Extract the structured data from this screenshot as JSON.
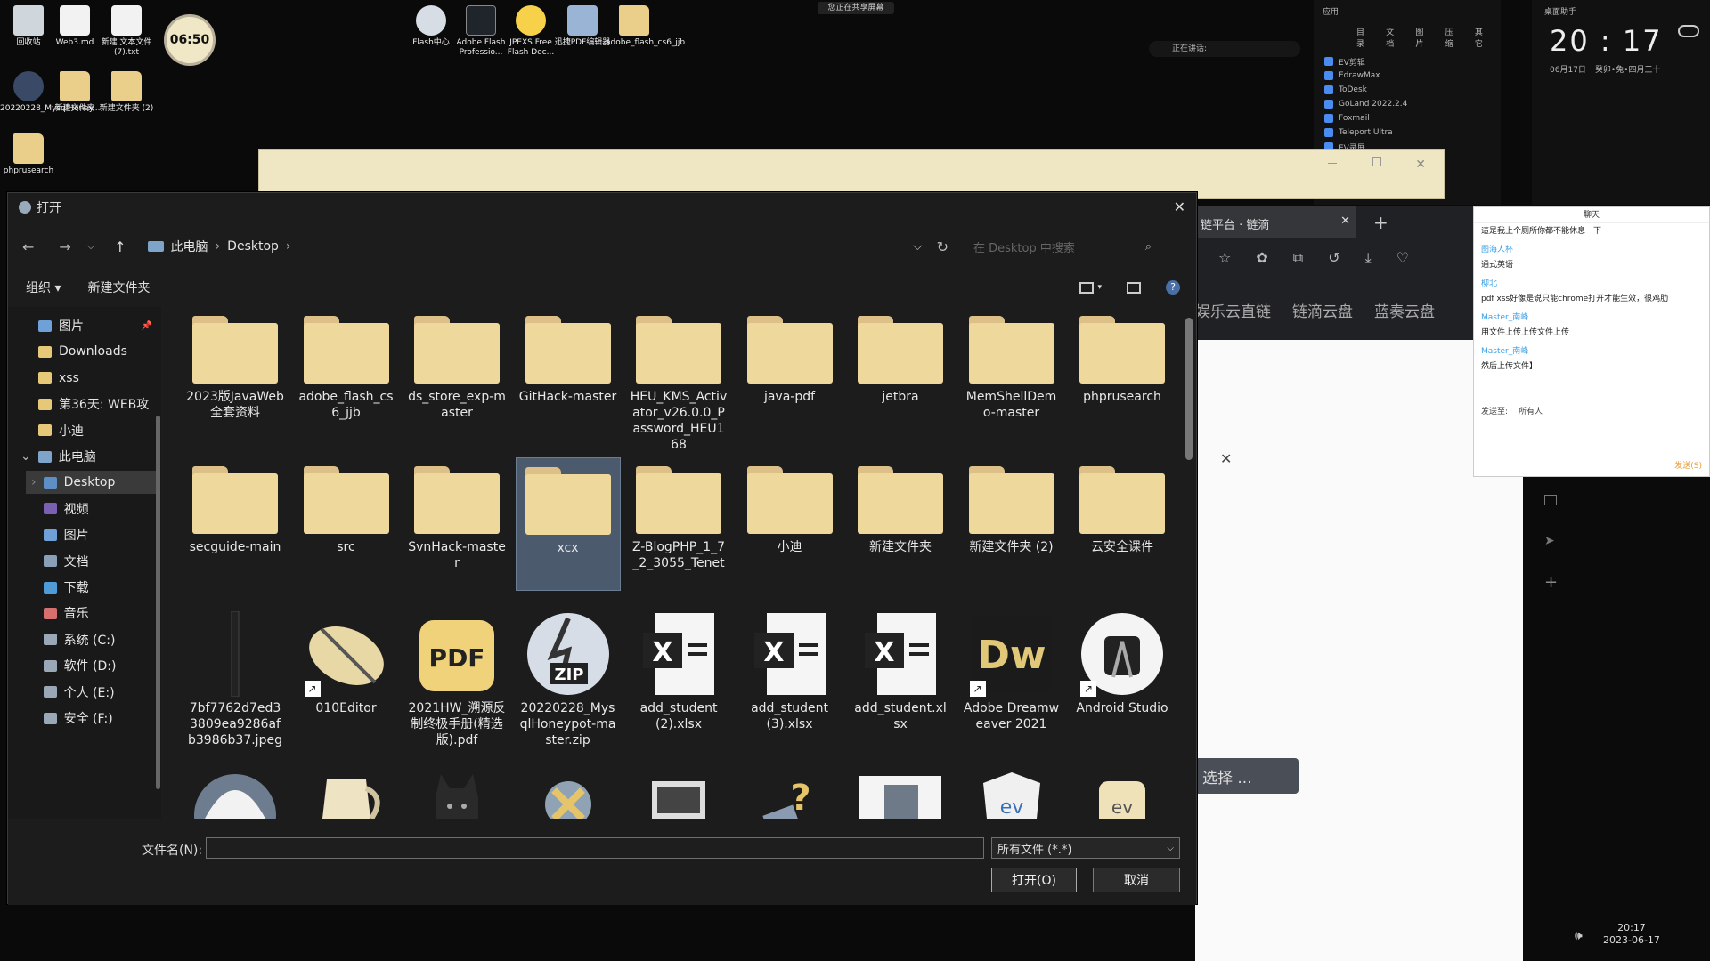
{
  "desktop": {
    "icons_left": [
      {
        "label": "回收站",
        "kind": "bin"
      },
      {
        "label": "Web3.md",
        "kind": "doc"
      },
      {
        "label": "新建 文本文件 (7).txt",
        "kind": "doc"
      },
      {
        "label": "20220228_MysqlHoney...",
        "kind": "zip"
      },
      {
        "label": "新建文件夹",
        "kind": "fold"
      },
      {
        "label": "新建文件夹 (2)",
        "kind": "fold"
      },
      {
        "label": "phprusearch",
        "kind": "fold"
      }
    ],
    "clock_widget": "06:50",
    "icons_top": [
      {
        "label": "Flash中心",
        "kind": "flash"
      },
      {
        "label": "Adobe Flash Professio...",
        "kind": "fl"
      },
      {
        "label": "JPEXS Free Flash Dec...",
        "kind": "ff"
      },
      {
        "label": "迅捷PDF编辑器",
        "kind": "pdf"
      },
      {
        "label": "adobe_flash_cs6_jjb",
        "kind": "fold"
      }
    ],
    "sharing_banner": "您正在共享屏幕",
    "speaking_label": "正在讲话:"
  },
  "app_panel": {
    "header": "应用",
    "tabs": [
      "目录",
      "文档",
      "图片",
      "压缩",
      "其它"
    ],
    "items": [
      "EV剪辑",
      "EdrawMax",
      "ToDesk",
      "GoLand 2022.2.4",
      "Foxmail",
      "Teleport Ultra",
      "EV录屏"
    ]
  },
  "time_panel": {
    "header": "桌面助手",
    "time": "20 : 17",
    "date": "06月17日",
    "lunar": "癸卯•兔•四月三十"
  },
  "browser": {
    "tab_title": "链平台 · 链滴",
    "bookmarks": [
      "娱乐云直链",
      "链滴云盘",
      "蓝奏云盘"
    ],
    "select_button": "选择 ..."
  },
  "chat": {
    "title": "聊天",
    "messages": [
      {
        "type": "msg",
        "text": "這是我上个厕所你都不能休息一下"
      },
      {
        "type": "name",
        "text": "图海人杯"
      },
      {
        "type": "msg",
        "text": "通式英语"
      },
      {
        "type": "name",
        "text": "柳北"
      },
      {
        "type": "msg",
        "text": "pdf xss好像是说只能chrome打开才能生效，很鸡肋"
      },
      {
        "type": "name",
        "text": "Master_南峰"
      },
      {
        "type": "msg",
        "text": "用文件上传上传文件上传"
      },
      {
        "type": "name",
        "text": "Master_南峰"
      },
      {
        "type": "msg",
        "text": "然后上传文件】"
      }
    ],
    "send_to_label": "发送至:",
    "send_to_value": "所有人",
    "send_button": "发送(S)"
  },
  "dialog": {
    "title": "打开",
    "breadcrumb": [
      "此电脑",
      "Desktop"
    ],
    "search_placeholder": "在 Desktop 中搜索",
    "organize": "组织",
    "new_folder": "新建文件夹",
    "sidebar": [
      {
        "label": "图片",
        "icon": "pictures",
        "indent": 1,
        "pin": true
      },
      {
        "label": "Downloads",
        "icon": "folder",
        "indent": 1
      },
      {
        "label": "xss",
        "icon": "folder",
        "indent": 1
      },
      {
        "label": "第36天: WEB攻",
        "icon": "folder",
        "indent": 1
      },
      {
        "label": "小迪",
        "icon": "folder",
        "indent": 1
      },
      {
        "label": "此电脑",
        "icon": "pc",
        "indent": 0,
        "expanded": true
      },
      {
        "label": "Desktop",
        "icon": "desktop",
        "indent": 1,
        "selected": true
      },
      {
        "label": "视频",
        "icon": "video",
        "indent": 1
      },
      {
        "label": "图片",
        "icon": "pictures",
        "indent": 1
      },
      {
        "label": "文档",
        "icon": "docs",
        "indent": 1
      },
      {
        "label": "下载",
        "icon": "download",
        "indent": 1
      },
      {
        "label": "音乐",
        "icon": "music",
        "indent": 1
      },
      {
        "label": "系统 (C:)",
        "icon": "drive",
        "indent": 1
      },
      {
        "label": "软件 (D:)",
        "icon": "drive",
        "indent": 1
      },
      {
        "label": "个人 (E:)",
        "icon": "drive",
        "indent": 1
      },
      {
        "label": "安全 (F:)",
        "icon": "drive",
        "indent": 1
      }
    ],
    "files": [
      {
        "name": "2023版JavaWeb全套资料",
        "kind": "folder"
      },
      {
        "name": "adobe_flash_cs6_jjb",
        "kind": "folder"
      },
      {
        "name": "ds_store_exp-master",
        "kind": "folder"
      },
      {
        "name": "GitHack-master",
        "kind": "folder"
      },
      {
        "name": "HEU_KMS_Activator_v26.0.0_Password_HEU168",
        "kind": "folder"
      },
      {
        "name": "java-pdf",
        "kind": "folder"
      },
      {
        "name": "jetbra",
        "kind": "folder"
      },
      {
        "name": "MemShellDemo-master",
        "kind": "folder"
      },
      {
        "name": "phprusearch",
        "kind": "folder"
      },
      {
        "name": "secguide-main",
        "kind": "folder"
      },
      {
        "name": "src",
        "kind": "folder"
      },
      {
        "name": "SvnHack-master",
        "kind": "folder"
      },
      {
        "name": "xcx",
        "kind": "folder",
        "selected": true
      },
      {
        "name": "Z-BlogPHP_1_7_2_3055_Tenet",
        "kind": "folder"
      },
      {
        "name": "小迪",
        "kind": "folder"
      },
      {
        "name": "新建文件夹",
        "kind": "folder"
      },
      {
        "name": "新建文件夹 (2)",
        "kind": "folder"
      },
      {
        "name": "云安全课件",
        "kind": "folder"
      },
      {
        "name": "7bf7762d7ed33809ea9286afb3986b37.jpeg",
        "kind": "jpeg"
      },
      {
        "name": "010Editor",
        "kind": "editor",
        "shortcut": true
      },
      {
        "name": "2021HW_溯源反制终极手册(精选版).pdf",
        "kind": "pdf"
      },
      {
        "name": "20220228_MysqlHoneypot-master.zip",
        "kind": "zip"
      },
      {
        "name": "add_student (2).xlsx",
        "kind": "xlsx"
      },
      {
        "name": "add_student (3).xlsx",
        "kind": "xlsx"
      },
      {
        "name": "add_student.xlsx",
        "kind": "xlsx"
      },
      {
        "name": "Adobe Dreamweaver 2021",
        "kind": "dw",
        "shortcut": true
      },
      {
        "name": "Android Studio",
        "kind": "android",
        "shortcut": true
      },
      {
        "name": "",
        "kind": "cap"
      },
      {
        "name": "",
        "kind": "jug"
      },
      {
        "name": "",
        "kind": "cat"
      },
      {
        "name": "",
        "kind": "tool"
      },
      {
        "name": "",
        "kind": "monitor"
      },
      {
        "name": "",
        "kind": "help"
      },
      {
        "name": "",
        "kind": "doc"
      },
      {
        "name": "",
        "kind": "ev"
      },
      {
        "name": "",
        "kind": "ev2"
      }
    ],
    "filename_label": "文件名(N):",
    "filename_value": "",
    "filetype": "所有文件 (*.*)",
    "open_button": "打开(O)",
    "cancel_button": "取消"
  },
  "taskbar": {
    "time": "20:17",
    "date": "2023-06-17"
  }
}
